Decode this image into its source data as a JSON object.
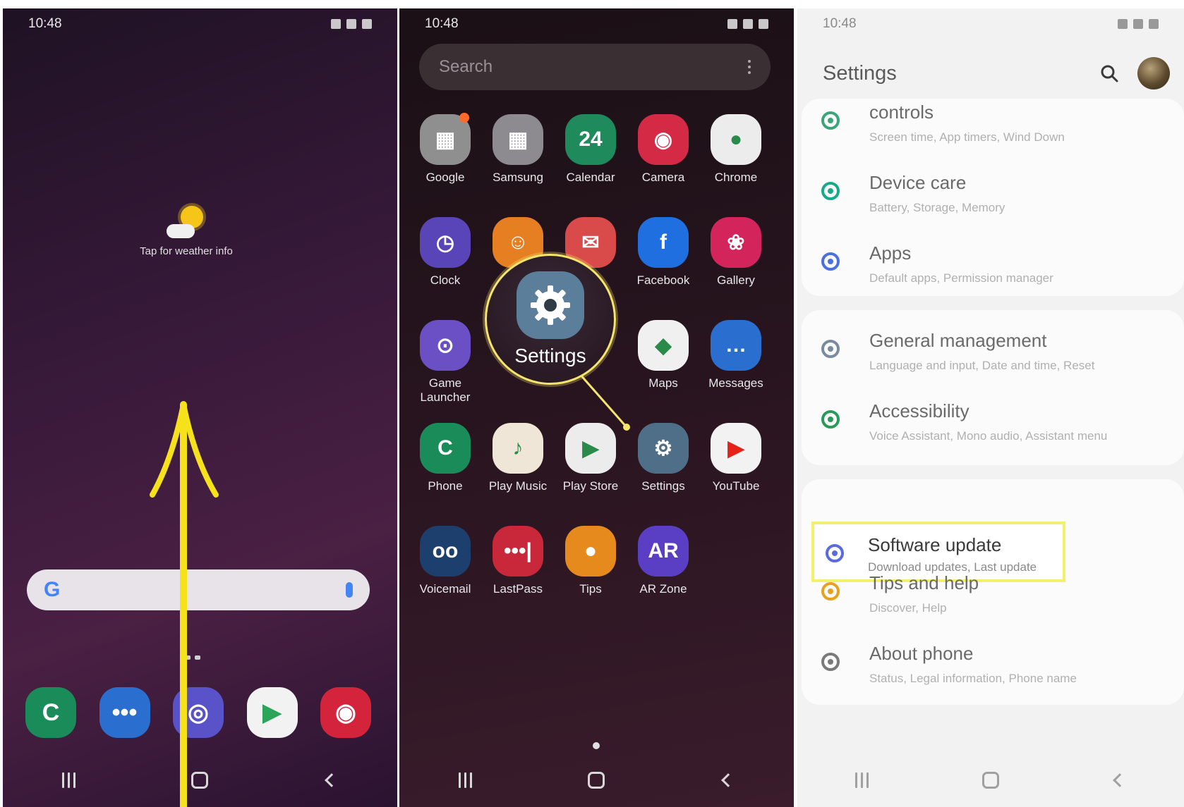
{
  "status_bar": {
    "time": "10:48"
  },
  "home_screen": {
    "weather_text": "Tap for weather info",
    "search_logo": "G",
    "dock": [
      {
        "name": "phone",
        "color": "#1a8c5a",
        "glyph": "C"
      },
      {
        "name": "messages",
        "color": "#2a6fd0",
        "glyph": "•••"
      },
      {
        "name": "internet",
        "color": "#5a52c8",
        "glyph": "◎"
      },
      {
        "name": "play-store",
        "color": "#f2f2f2",
        "glyph": "▶"
      },
      {
        "name": "camera",
        "color": "#d3243c",
        "glyph": "◉"
      }
    ]
  },
  "app_drawer": {
    "search_placeholder": "Search",
    "apps": [
      {
        "label": "Google",
        "color": "#8f8f8f",
        "glyph": "▦",
        "badge": true
      },
      {
        "label": "Samsung",
        "color": "#8d8a90",
        "glyph": "▦"
      },
      {
        "label": "Calendar",
        "color": "#1f8a5c",
        "glyph": "24"
      },
      {
        "label": "Camera",
        "color": "#d42a45",
        "glyph": "◉"
      },
      {
        "label": "Chrome",
        "color": "#ececec",
        "glyph": "●"
      },
      {
        "label": "Clock",
        "color": "#5a45b8",
        "glyph": "◷"
      },
      {
        "label": "",
        "color": "#e67e22",
        "glyph": "☺"
      },
      {
        "label": "",
        "color": "#d94a4a",
        "glyph": "✉"
      },
      {
        "label": "Facebook",
        "color": "#1f6fe0",
        "glyph": "f"
      },
      {
        "label": "Gallery",
        "color": "#d4245c",
        "glyph": "❀"
      },
      {
        "label": "Game\nLauncher",
        "color": "#6b4fc4",
        "glyph": "⊙"
      },
      {
        "label": "",
        "color": "transparent",
        "glyph": ""
      },
      {
        "label": "",
        "color": "transparent",
        "glyph": ""
      },
      {
        "label": "Maps",
        "color": "#f0f0f0",
        "glyph": "◆"
      },
      {
        "label": "Messages",
        "color": "#2a6fd0",
        "glyph": "…"
      },
      {
        "label": "Phone",
        "color": "#1a8c5a",
        "glyph": "C"
      },
      {
        "label": "Play Music",
        "color": "#f0e6d8",
        "glyph": "♪"
      },
      {
        "label": "Play Store",
        "color": "#ececec",
        "glyph": "▶"
      },
      {
        "label": "Settings",
        "color": "#4f6f88",
        "glyph": "⚙"
      },
      {
        "label": "YouTube",
        "color": "#f2f2f2",
        "glyph": "▶"
      },
      {
        "label": "Voicemail",
        "color": "#1d3f6e",
        "glyph": "oo"
      },
      {
        "label": "LastPass",
        "color": "#c8283a",
        "glyph": "•••|"
      },
      {
        "label": "Tips",
        "color": "#e68a1e",
        "glyph": "●"
      },
      {
        "label": "AR Zone",
        "color": "#5a3fc4",
        "glyph": "AR"
      }
    ],
    "magnifier_label": "Settings"
  },
  "settings": {
    "title": "Settings",
    "items": [
      {
        "title": "controls",
        "subtitle": "Screen time, App timers, Wind Down",
        "icon": "digital-wellbeing-icon",
        "icon_color": "#3aa57a"
      },
      {
        "title": "Device care",
        "subtitle": "Battery, Storage, Memory",
        "icon": "device-care-icon",
        "icon_color": "#18a88a"
      },
      {
        "title": "Apps",
        "subtitle": "Default apps, Permission manager",
        "icon": "apps-icon",
        "icon_color": "#4a6fe0"
      },
      {
        "title": "General management",
        "subtitle": "Language and input, Date and time, Reset",
        "icon": "sliders-icon",
        "icon_color": "#7a8aa0"
      },
      {
        "title": "Accessibility",
        "subtitle": "Voice Assistant, Mono audio, Assistant menu",
        "icon": "accessibility-icon",
        "icon_color": "#2a9a5a"
      },
      {
        "title": "Software update",
        "subtitle": "Download updates, Last update",
        "icon": "software-update-icon",
        "icon_color": "#5a6ae0"
      },
      {
        "title": "Tips and help",
        "subtitle": "Discover, Help",
        "icon": "lightbulb-icon",
        "icon_color": "#e6a21e"
      },
      {
        "title": "About phone",
        "subtitle": "Status, Legal information, Phone name",
        "icon": "info-icon",
        "icon_color": "#7a7a7a"
      }
    ]
  },
  "colors": {
    "highlight": "#f3f06b",
    "arrow": "#f5e21a"
  }
}
